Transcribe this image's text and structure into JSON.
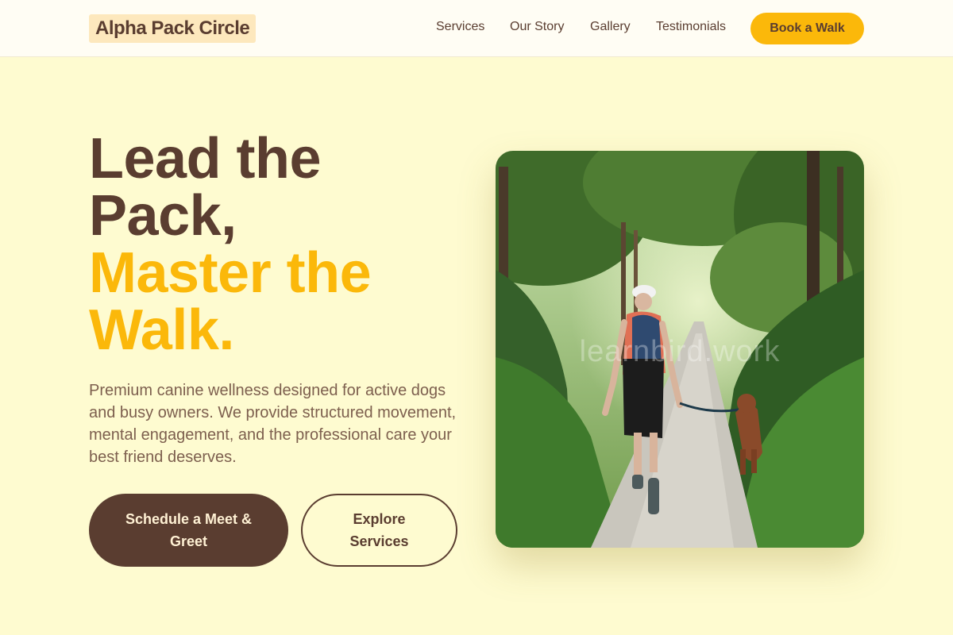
{
  "header": {
    "logo": "Alpha Pack Circle",
    "nav": [
      "Services",
      "Our Story",
      "Gallery",
      "Testimonials"
    ],
    "cta": "Book a Walk"
  },
  "hero": {
    "title_line1": "Lead the",
    "title_line2": "Pack,",
    "title_line3": "Master the",
    "title_line4": "Walk.",
    "description": "Premium canine wellness designed for active dogs and busy owners. We provide structured movement, mental engagement, and the professional care your best friend deserves.",
    "primary_cta": "Schedule a Meet & Greet",
    "secondary_cta": "Explore Services",
    "image_watermark": "learnbird.work"
  },
  "colors": {
    "background": "#fefbd0",
    "header_background": "#fffdf4",
    "brown": "#5a3d30",
    "accent": "#fbb80a",
    "logo_highlight": "#fde8bd"
  }
}
